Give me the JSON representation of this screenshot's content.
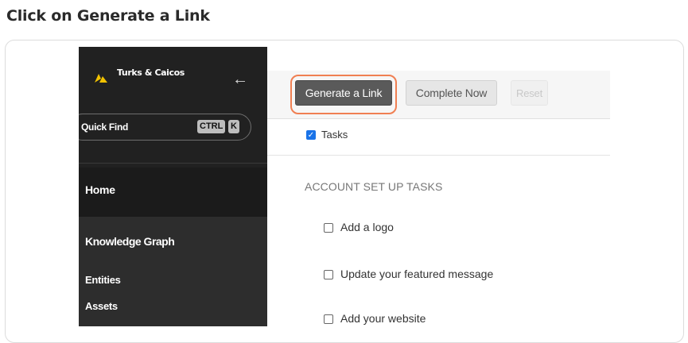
{
  "step": {
    "title": "Click on Generate a Link"
  },
  "sidebar": {
    "brand": "Turks & Caicos",
    "back_icon": "arrow-left-icon",
    "quick_find": {
      "label": "Quick Find",
      "shortcut_ctrl": "CTRL",
      "shortcut_key": "K"
    },
    "home": "Home",
    "section": "Knowledge Graph",
    "items": [
      {
        "label": "Entities"
      },
      {
        "label": "Assets"
      }
    ]
  },
  "toolbar": {
    "generate_label": "Generate a Link",
    "complete_label": "Complete Now",
    "reset_label": "Reset",
    "highlight_color": "#f07f52"
  },
  "tasks": {
    "toggle_label": "Tasks",
    "toggle_checked": true,
    "section_heading": "ACCOUNT SET UP TASKS",
    "items": [
      {
        "label": "Add a logo",
        "checked": false
      },
      {
        "label": "Update your featured message",
        "checked": false
      },
      {
        "label": "Add your website",
        "checked": false
      }
    ]
  }
}
